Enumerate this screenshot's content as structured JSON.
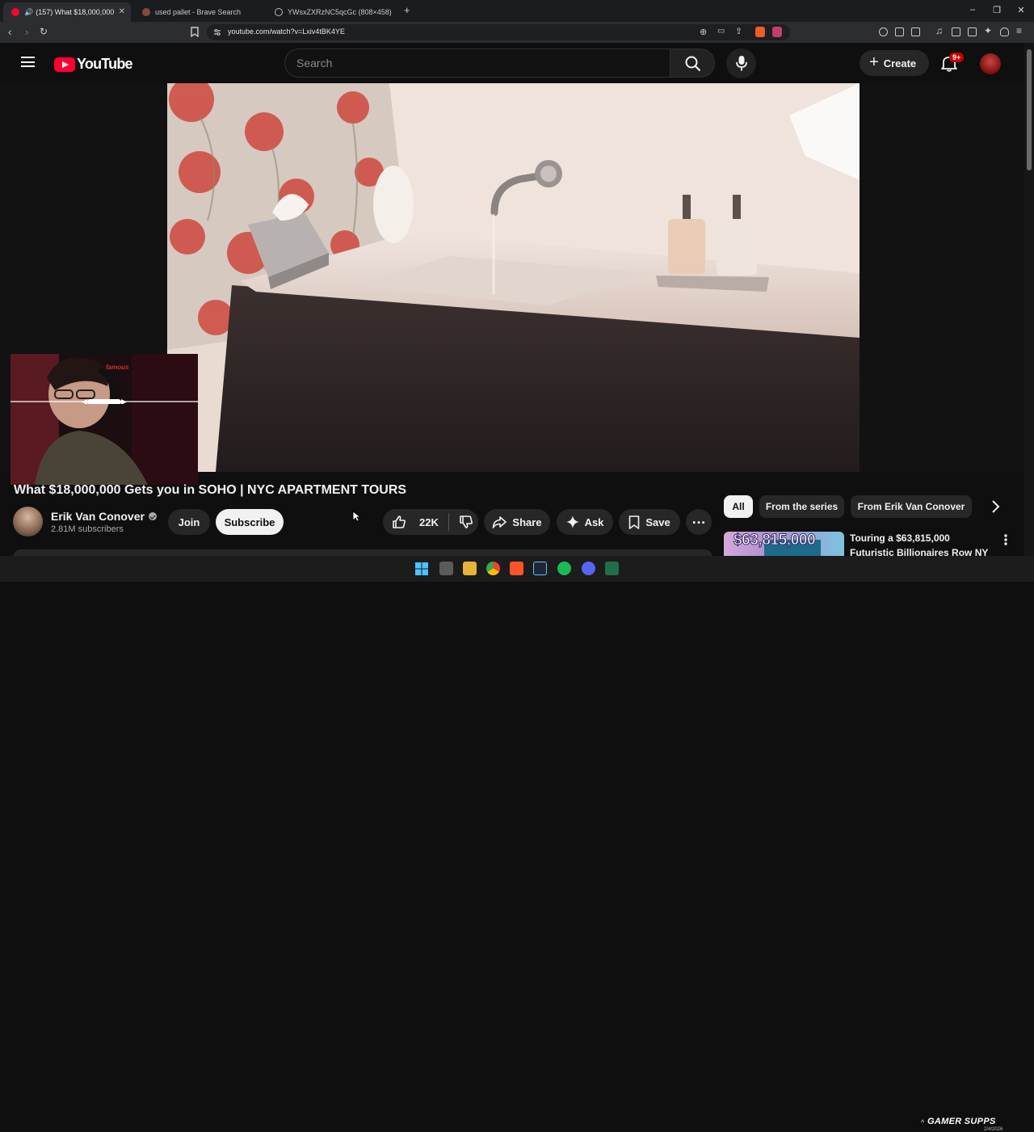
{
  "browser": {
    "tabs": [
      {
        "label": "(157) What $18,000,000 Gets",
        "active": true
      },
      {
        "label": "used pallet - Brave Search",
        "active": false
      },
      {
        "label": "YWsxZXRzNC5qcGc (808×458)",
        "active": false
      }
    ],
    "new_tab": "+",
    "window_controls": {
      "minimize": "–",
      "restore": "❐",
      "close": "✕"
    },
    "url": "youtube.com/watch?v=Lxiv4tBK4YE"
  },
  "youtube": {
    "logo_text": "YouTube",
    "search": {
      "placeholder": "Search"
    },
    "create_label": "Create",
    "notifications_badge": "9+"
  },
  "video": {
    "title": "What $18,000,000 Gets you in SOHO | NYC APARTMENT TOURS",
    "webcam_sign": "famous"
  },
  "channel": {
    "name": "Erik Van Conover",
    "subscribers": "2.81M subscribers",
    "join_label": "Join",
    "subscribe_label": "Subscribe"
  },
  "actions": {
    "like_count": "22K",
    "share_label": "Share",
    "ask_label": "Ask",
    "save_label": "Save"
  },
  "chips": [
    {
      "label": "All",
      "active": true
    },
    {
      "label": "From the series",
      "active": false
    },
    {
      "label": "From Erik Van Conover",
      "active": false
    }
  ],
  "recommendation": {
    "thumb_text": "$63,815,000",
    "title_line1": "Touring a $63,815,000",
    "title_line2": "Futuristic Billionaires Row NY"
  },
  "overlay": {
    "brand": "GAMER SUPPS",
    "date": "2/4/2026"
  },
  "colors": {
    "yt_red": "#ff0033",
    "background": "#0f0f0f",
    "chip_active": "#f1f1f1",
    "pill": "#272727"
  }
}
